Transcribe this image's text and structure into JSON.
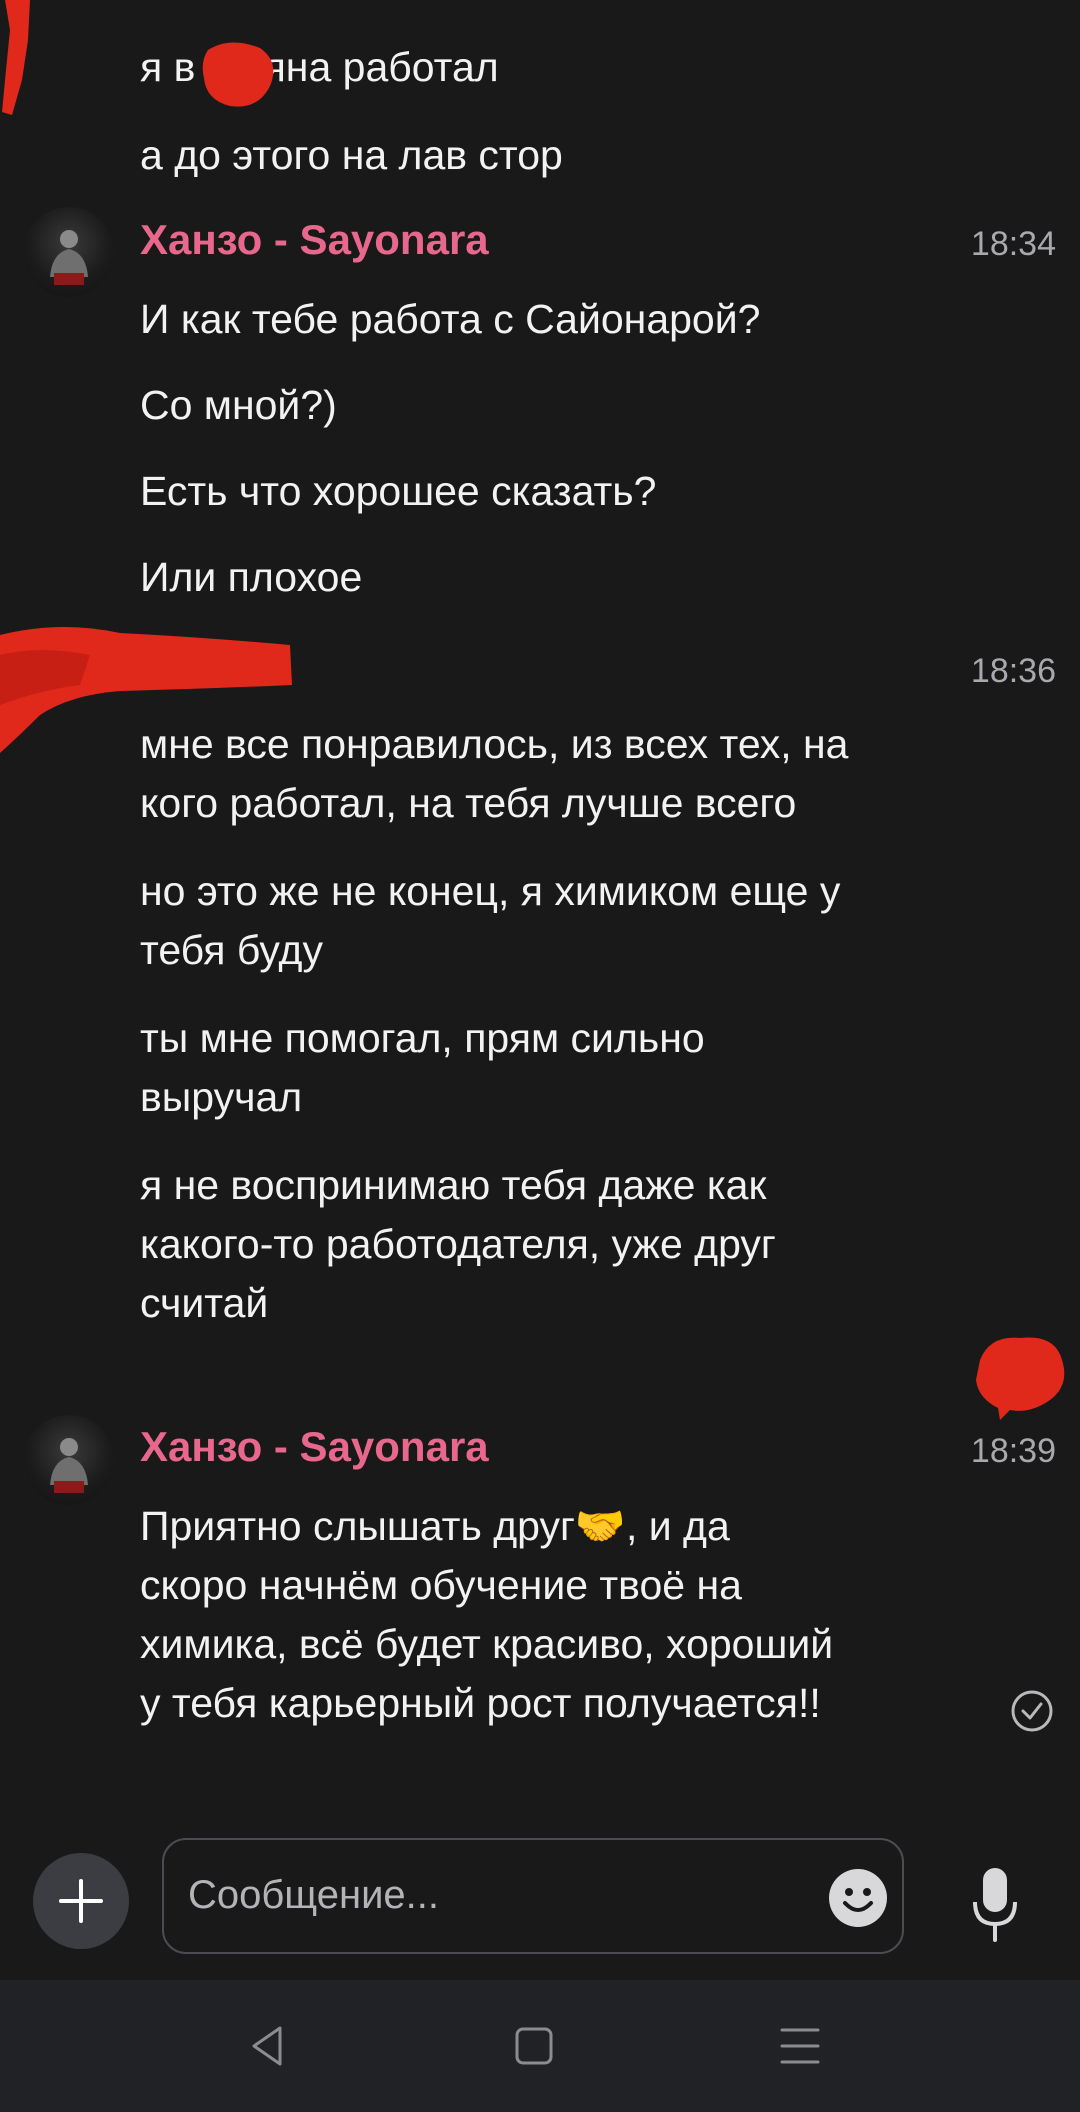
{
  "messages_top": [
    {
      "text": "я в      на яна работал"
    },
    {
      "text": "а до этого на лав стор"
    }
  ],
  "group1": {
    "author": "Ханзо - Sayonara",
    "time": "18:34",
    "lines": [
      "И как тебе работа с Сайонарой?",
      "Со мной?)",
      "Есть что хорошее сказать?",
      "Или плохое"
    ]
  },
  "group2": {
    "time": "18:36",
    "lines": [
      "мне все понравилось, из всех тех, на\nкого работал, на тебя лучше всего",
      "но это же не конец, я химиком еще у\nтебя буду",
      "ты мне помогал, прям сильно\nвыручал",
      "я не воспринимаю тебя даже как\nкакого-то работодателя, уже друг\nсчитай"
    ]
  },
  "group3": {
    "author": "Ханзо - Sayonara",
    "time": "18:39",
    "message_text": "Приятно слышать друг🤝, и да\nскоро начнём обучение твоё на\nхимика, всё будет красиво, хороший\nу тебя карьерный рост получается!!",
    "status_icon": "read-check-icon"
  },
  "composer": {
    "placeholder": "Сообщение...",
    "plus_icon": "plus-icon",
    "emoji_icon": "emoji-icon",
    "mic_icon": "microphone-icon"
  },
  "nav": {
    "back_icon": "back-triangle-icon",
    "home_icon": "home-square-icon",
    "menu_icon": "menu-lines-icon"
  },
  "colors": {
    "background": "#19191a",
    "author_name": "#e8678d",
    "text": "#f2f2f2",
    "timestamp": "#a9a9ad",
    "redaction": "#e0291b"
  }
}
